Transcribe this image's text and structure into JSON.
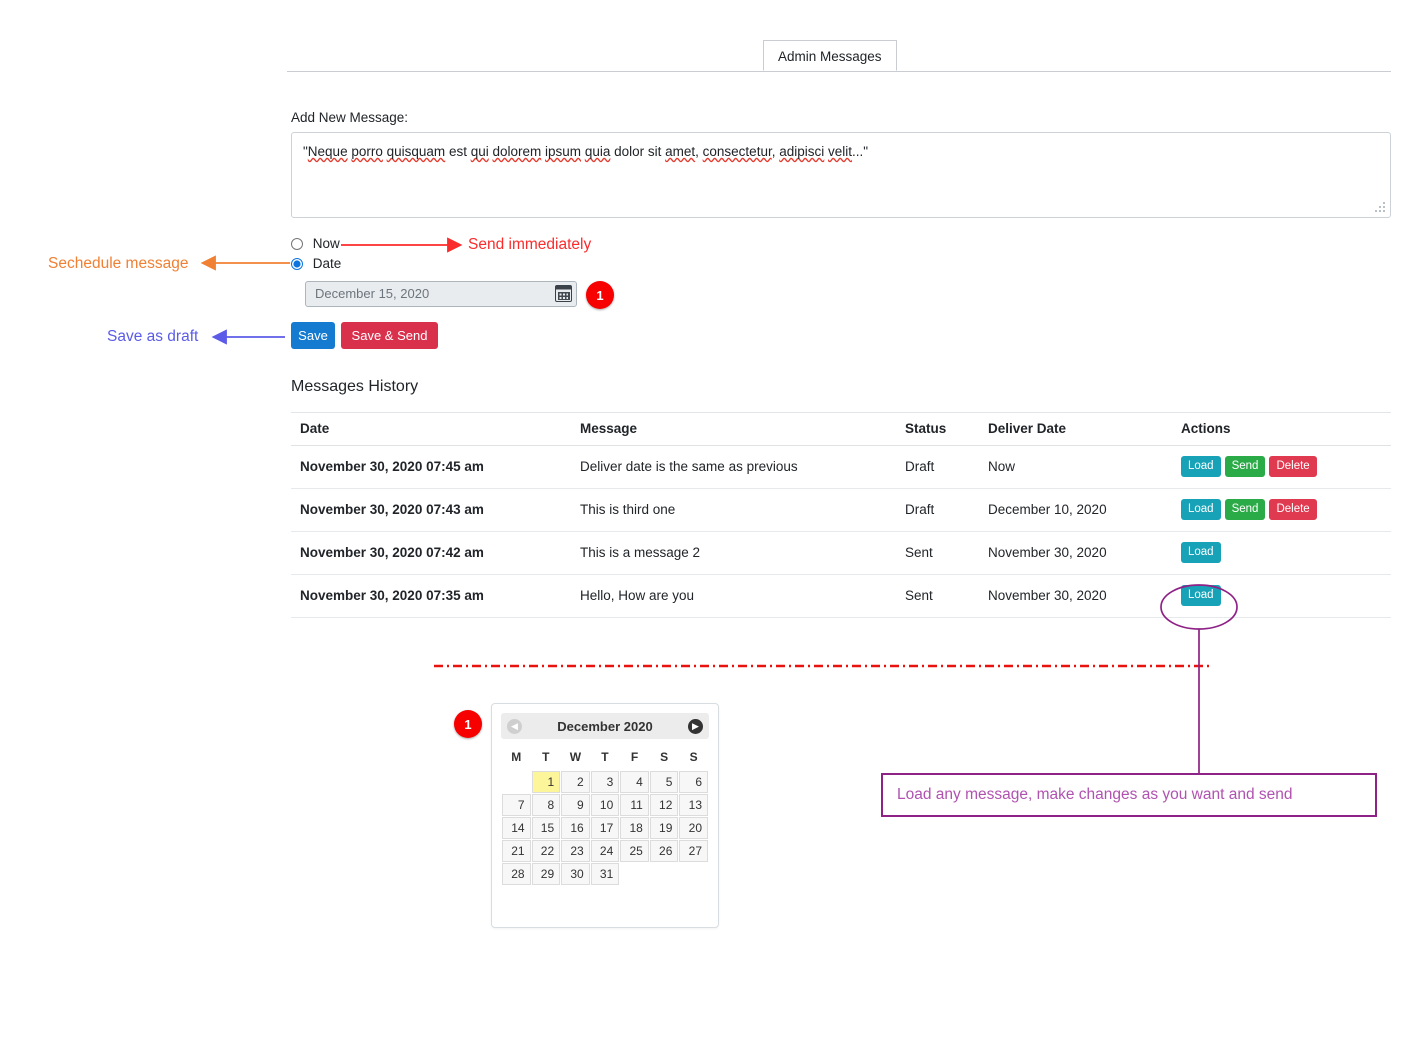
{
  "tab": {
    "label": "Admin Messages"
  },
  "form": {
    "add_label": "Add New Message:",
    "message_value": "\"Neque porro quisquam est qui dolorem ipsum quia dolor sit amet, consectetur, adipisci velit...\"",
    "radio_now_label": "Now",
    "radio_date_label": "Date",
    "radio_selected": "Date",
    "date_value": "December 15, 2020",
    "calendar_icon": "calendar-icon",
    "save_label": "Save",
    "save_send_label": "Save & Send",
    "badge_date": "1"
  },
  "history": {
    "title": "Messages History",
    "columns": [
      "Date",
      "Message",
      "Status",
      "Deliver Date",
      "Actions"
    ],
    "rows": [
      {
        "date": "November 30, 2020 07:45 am",
        "message": "Deliver date is the same as previous",
        "status": "Draft",
        "deliver_date": "Now",
        "actions": [
          "Load",
          "Send",
          "Delete"
        ]
      },
      {
        "date": "November 30, 2020 07:43 am",
        "message": "This is third one",
        "status": "Draft",
        "deliver_date": "December 10, 2020",
        "actions": [
          "Load",
          "Send",
          "Delete"
        ]
      },
      {
        "date": "November 30, 2020 07:42 am",
        "message": "This is a message 2",
        "status": "Sent",
        "deliver_date": "November 30, 2020",
        "actions": [
          "Load"
        ]
      },
      {
        "date": "November 30, 2020 07:35 am",
        "message": "Hello, How are you",
        "status": "Sent",
        "deliver_date": "November 30, 2020",
        "actions": [
          "Load"
        ]
      }
    ]
  },
  "datepicker": {
    "badge": "1",
    "title": "December 2020",
    "prev_icon": "chevron-left-icon",
    "next_icon": "chevron-right-icon",
    "weekdays": [
      "M",
      "T",
      "W",
      "T",
      "F",
      "S",
      "S"
    ],
    "leading_blanks": 1,
    "days": [
      1,
      2,
      3,
      4,
      5,
      6,
      7,
      8,
      9,
      10,
      11,
      12,
      13,
      14,
      15,
      16,
      17,
      18,
      19,
      20,
      21,
      22,
      23,
      24,
      25,
      26,
      27,
      28,
      29,
      30,
      31
    ],
    "highlighted_day": 1
  },
  "annotations": {
    "send_immediately": "Send immediately",
    "sechedule_message": "Sechedule message",
    "save_as_draft": "Save as draft",
    "load_any_message": "Load any message, make changes as you want and send"
  },
  "colors": {
    "red_arrow": "#fb2c2c",
    "orange_arrow": "#f08033",
    "blue_arrow": "#5b5be8",
    "purple": "#8e2287",
    "purple_text": "#b052b0",
    "badge_red": "#f60000",
    "divider_red": "#e8120f",
    "btn_save": "#147bd1",
    "btn_save_send": "#d9304c",
    "btn_load": "#18a2b8",
    "btn_send": "#2bab47",
    "btn_delete": "#e03a51",
    "today_highlight": "#fdf59a"
  }
}
